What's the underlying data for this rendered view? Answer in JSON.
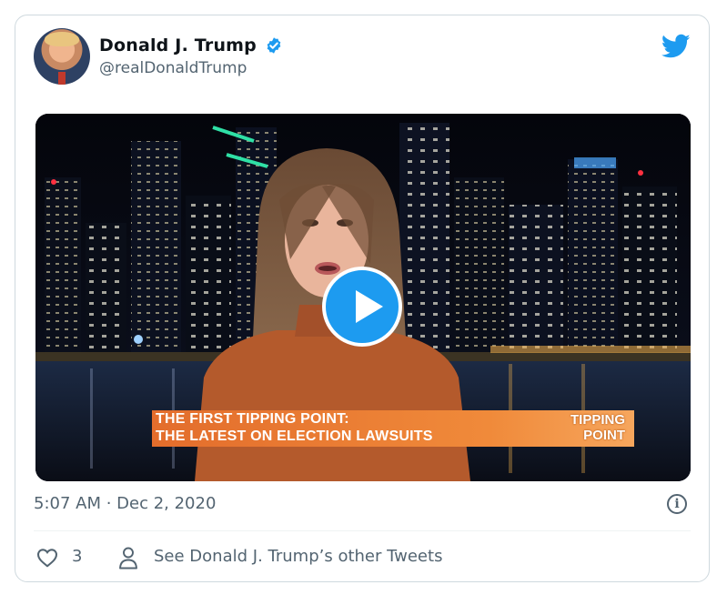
{
  "author": {
    "name": "Donald J. Trump",
    "handle": "@realDonaldTrump",
    "verified": true,
    "avatar_icon": "profile-photo"
  },
  "media": {
    "type": "video",
    "lower_third": {
      "line1": "THE FIRST TIPPING POINT:",
      "line2": "THE LATEST ON ELECTION LAWSUITS",
      "logo_line1": "TIPPING",
      "logo_line2": "POINT"
    }
  },
  "timestamp": "5:07 AM · Dec 2, 2020",
  "actions": {
    "like_count": "3",
    "see_more": "See Donald J. Trump’s other Tweets"
  },
  "colors": {
    "brand": "#1d9bf0",
    "secondary_text": "#536471",
    "border": "#cfd9de",
    "lower_third": "#ee7f35"
  },
  "icons": [
    "verified-badge-icon",
    "twitter-bird-icon",
    "play-icon",
    "info-icon",
    "heart-icon",
    "person-icon"
  ]
}
